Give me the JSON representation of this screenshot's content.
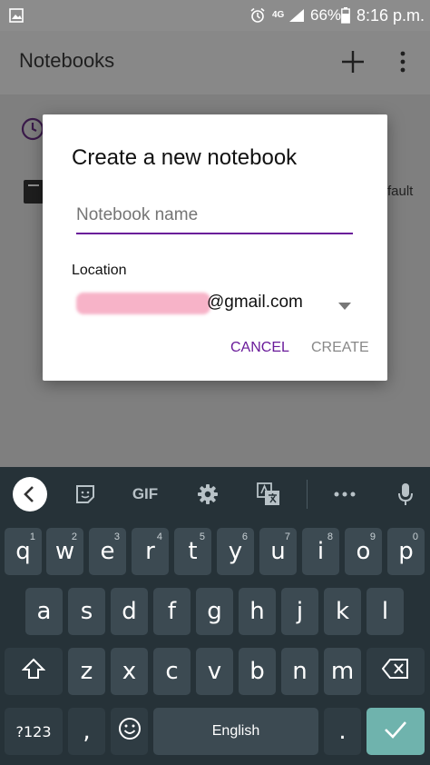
{
  "status_bar": {
    "network_label": "4G",
    "battery_percent": "66%",
    "time": "8:16 p.m.",
    "icons": [
      "gallery-icon",
      "alarm-icon",
      "signal-icon",
      "battery-icon"
    ]
  },
  "app_bar": {
    "title": "Notebooks",
    "icons": [
      "add-icon",
      "more-vert-icon"
    ]
  },
  "background": {
    "list_item_partial_text": "fault",
    "icons": [
      "clock-icon",
      "notebook-icon"
    ]
  },
  "dialog": {
    "title": "Create a new notebook",
    "name_placeholder": "Notebook name",
    "location_label": "Location",
    "location_value": "@gmail.com",
    "cancel_label": "CANCEL",
    "create_label": "CREATE",
    "accent_color": "#6a1b9a"
  },
  "keyboard": {
    "toolbar_icons": [
      "back-icon",
      "sticker-icon",
      "gif-icon",
      "settings-icon",
      "translate-icon",
      "more-icon",
      "mic-icon"
    ],
    "gif_label": "GIF",
    "row1": [
      {
        "k": "q",
        "h": "1"
      },
      {
        "k": "w",
        "h": "2"
      },
      {
        "k": "e",
        "h": "3"
      },
      {
        "k": "r",
        "h": "4"
      },
      {
        "k": "t",
        "h": "5"
      },
      {
        "k": "y",
        "h": "6"
      },
      {
        "k": "u",
        "h": "7"
      },
      {
        "k": "i",
        "h": "8"
      },
      {
        "k": "o",
        "h": "9"
      },
      {
        "k": "p",
        "h": "0"
      }
    ],
    "row2": [
      "a",
      "s",
      "d",
      "f",
      "g",
      "h",
      "j",
      "k",
      "l"
    ],
    "row3": [
      "z",
      "x",
      "c",
      "v",
      "b",
      "n",
      "m"
    ],
    "symbols_label": "?123",
    "comma_label": ",",
    "space_label": "English",
    "period_label": ".",
    "enter_color": "#6fb3ad"
  }
}
